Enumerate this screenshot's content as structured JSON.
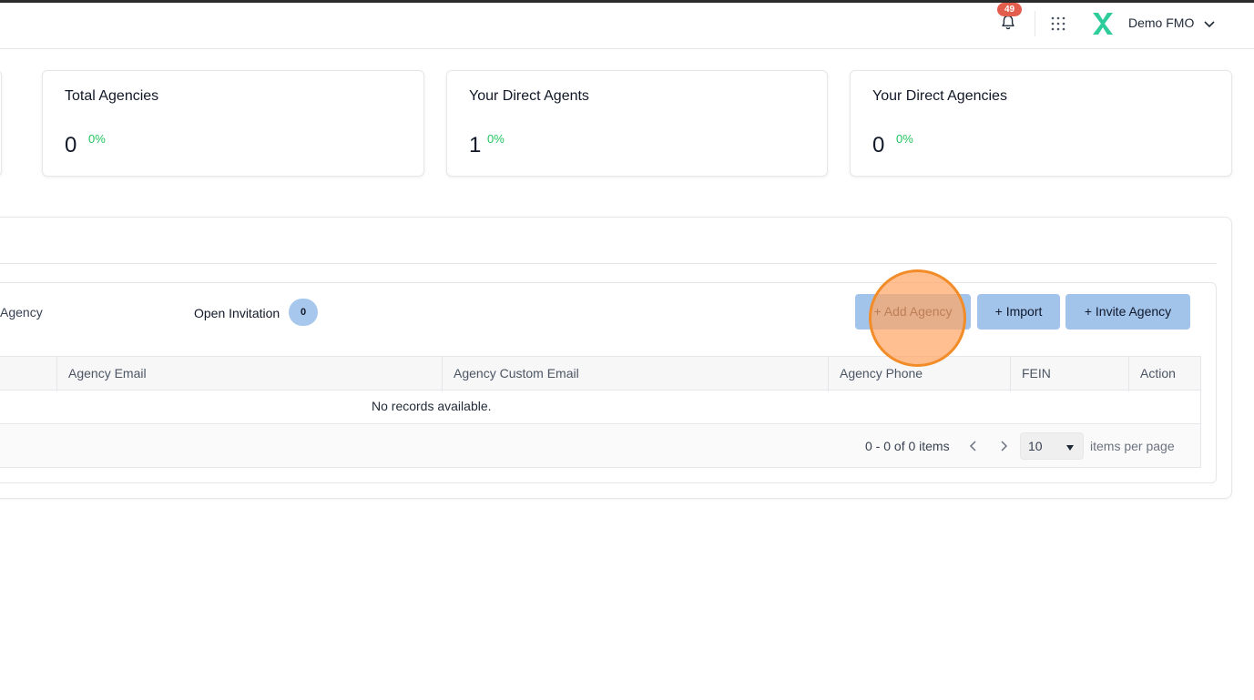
{
  "header": {
    "notification_count": "49",
    "user_name": "Demo FMO"
  },
  "stats": [
    {
      "title": "Total Agencies",
      "value": "0",
      "percent": "0%"
    },
    {
      "title": "Your Direct Agents",
      "value": "1",
      "percent": "0%"
    },
    {
      "title": "Your Direct Agencies",
      "value": "0",
      "percent": "0%"
    }
  ],
  "tabs": {
    "agency_label": "Agency",
    "open_invitation_label": "Open Invitation",
    "open_invitation_count": "0"
  },
  "toolbar": {
    "add_agency": "+ Add Agency",
    "import": "+ Import",
    "invite_agency": "+ Invite Agency"
  },
  "table": {
    "columns": [
      "Agency Email",
      "Agency Custom Email",
      "Agency Phone",
      "FEIN",
      "Action"
    ],
    "empty_message": "No records available."
  },
  "pager": {
    "info": "0 - 0 of 0 items",
    "page_size": "10",
    "per_page_label": "items per page"
  },
  "colors": {
    "accent_button": "#a3c4ea",
    "positive": "#22c55e",
    "badge": "#e35d4d",
    "logo_green": "#2ecc9a"
  },
  "icons": [
    "bell-icon",
    "apps-grid-icon",
    "logo-icon",
    "chevron-down-icon",
    "chevron-left-icon",
    "chevron-right-icon",
    "caret-down-icon"
  ]
}
